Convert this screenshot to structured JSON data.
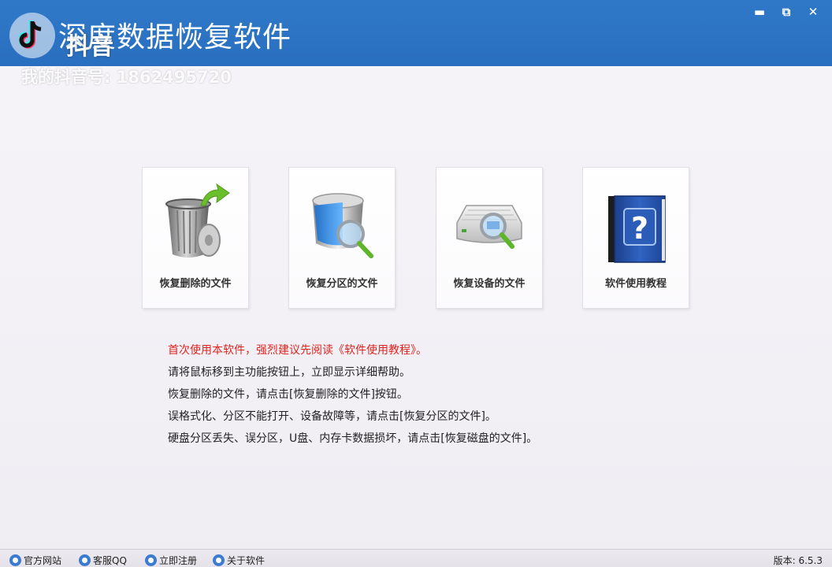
{
  "window": {
    "title": "深度数据恢复软件",
    "controls": {
      "minimize": "▬",
      "restore": "⧉",
      "close": "✕"
    }
  },
  "watermark": {
    "brand": "抖音",
    "account": "我的抖音号: 1862495720",
    "icon": "tiktok-note-icon"
  },
  "cards": [
    {
      "label": "恢复删除的文件",
      "icon": "recycle-bin-restore-icon"
    },
    {
      "label": "恢复分区的文件",
      "icon": "partition-search-icon"
    },
    {
      "label": "恢复设备的文件",
      "icon": "device-search-icon"
    },
    {
      "label": "软件使用教程",
      "icon": "help-book-icon"
    }
  ],
  "help": {
    "lines": [
      "首次使用本软件，强烈建议先阅读《软件使用教程》。",
      "请将鼠标移到主功能按钮上，立即显示详细帮助。",
      "恢复删除的文件，请点击[恢复删除的文件]按钮。",
      "误格式化、分区不能打开、设备故障等，请点击[恢复分区的文件]。",
      "硬盘分区丢失、误分区，U盘、内存卡数据损坏，请点击[恢复磁盘的文件]。"
    ],
    "warn_color": "#e0251f"
  },
  "statusbar": {
    "items": [
      {
        "label": "官方网站",
        "icon": "home-icon"
      },
      {
        "label": "客服QQ",
        "icon": "qq-icon"
      },
      {
        "label": "立即注册",
        "icon": "register-icon"
      },
      {
        "label": "关于软件",
        "icon": "info-icon"
      }
    ],
    "version": "版本: 6.5.3"
  },
  "colors": {
    "titlebar": "#2a6fbf",
    "accent": "#3b7bd0"
  }
}
